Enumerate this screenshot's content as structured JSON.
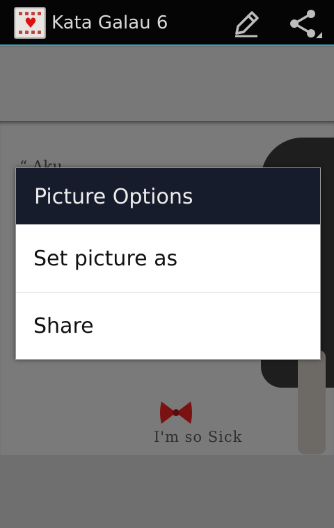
{
  "action_bar": {
    "app_icon": "app-launcher-icon",
    "title": "Kata Galau 6",
    "edit_icon": "pencil-icon",
    "share_icon": "share-icon"
  },
  "picture": {
    "quote_fragment": "“ Aku ...",
    "caption": "I'm so Sick"
  },
  "dialog": {
    "title": "Picture Options",
    "items": [
      {
        "label": "Set picture as"
      },
      {
        "label": "Share"
      }
    ]
  },
  "colors": {
    "action_bar_bg": "#050505",
    "action_bar_accent": "#3a9fb6",
    "dialog_header_bg": "#161c2b",
    "dialog_bg": "#ffffff",
    "dim_overlay": "#6f6f6f"
  }
}
